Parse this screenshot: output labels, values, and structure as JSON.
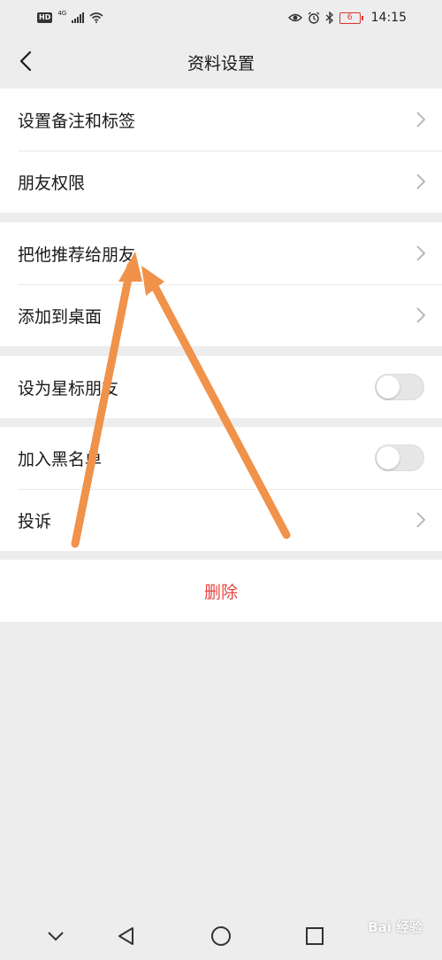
{
  "status_bar": {
    "hd": "HD",
    "network": "4G",
    "battery_level": "6",
    "time": "14:15",
    "icons": [
      "signal-icon",
      "wifi-icon",
      "eye-icon",
      "alarm-icon",
      "bluetooth-icon",
      "battery-icon"
    ]
  },
  "header": {
    "title": "资料设置",
    "back_icon": "back-chevron-icon"
  },
  "groups": {
    "g1": {
      "items": [
        {
          "label": "设置备注和标签"
        },
        {
          "label": "朋友权限"
        }
      ]
    },
    "g2": {
      "items": [
        {
          "label": "把他推荐给朋友"
        },
        {
          "label": "添加到桌面"
        }
      ]
    },
    "g3": {
      "items": [
        {
          "label": "设为星标朋友",
          "toggle": false
        }
      ]
    },
    "g4": {
      "items": [
        {
          "label": "加入黑名单",
          "toggle": false
        },
        {
          "label": "投诉"
        }
      ]
    }
  },
  "delete": {
    "label": "删除"
  },
  "system_nav": {
    "icons": [
      "collapse-chevron-icon",
      "back-triangle-icon",
      "home-circle-icon",
      "recents-square-icon"
    ]
  },
  "watermark": {
    "text": "Bai 经验"
  },
  "colors": {
    "background": "#ededed",
    "delete_red": "#e64340",
    "annotation_arrow": "#f0924a"
  }
}
